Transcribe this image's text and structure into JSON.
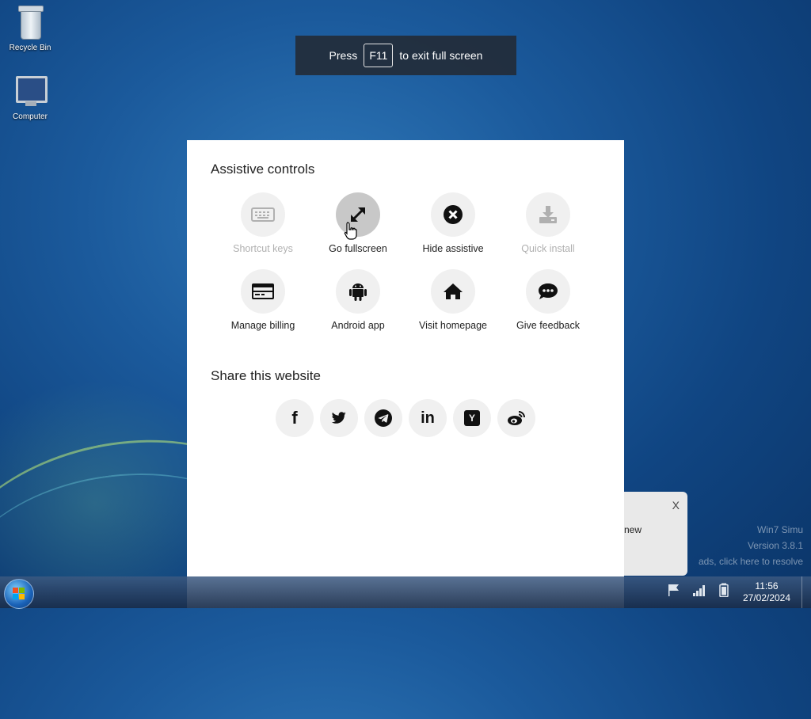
{
  "desktop": {
    "icons": [
      {
        "label": "Recycle Bin"
      },
      {
        "label": "Computer"
      }
    ]
  },
  "fullscreen_banner": {
    "prefix": "Press",
    "key": "F11",
    "suffix": "to exit full screen"
  },
  "panel": {
    "assistive_title": "Assistive controls",
    "controls": [
      {
        "label": "Shortcut keys",
        "icon": "keyboard-icon",
        "state": "disabled"
      },
      {
        "label": "Go fullscreen",
        "icon": "expand-icon",
        "state": "active"
      },
      {
        "label": "Hide assistive",
        "icon": "close-circle-icon",
        "state": "enabled"
      },
      {
        "label": "Quick install",
        "icon": "download-icon",
        "state": "disabled"
      },
      {
        "label": "Manage billing",
        "icon": "credit-card-icon",
        "state": "enabled"
      },
      {
        "label": "Android app",
        "icon": "android-icon",
        "state": "enabled"
      },
      {
        "label": "Visit homepage",
        "icon": "home-icon",
        "state": "enabled"
      },
      {
        "label": "Give feedback",
        "icon": "chat-icon",
        "state": "enabled"
      }
    ],
    "share_title": "Share this website",
    "share": [
      {
        "icon": "facebook-icon",
        "glyph": "f"
      },
      {
        "icon": "twitter-icon",
        "glyph": ""
      },
      {
        "icon": "telegram-icon",
        "glyph": ""
      },
      {
        "icon": "linkedin-icon",
        "glyph": "in"
      },
      {
        "icon": "ycombinator-icon",
        "glyph": "Y"
      },
      {
        "icon": "weibo-icon",
        "glyph": ""
      }
    ]
  },
  "notification": {
    "close": "X",
    "text": "new"
  },
  "watermark": {
    "line1": "Win7 Simu",
    "line2": "Version 3.8.1",
    "line3": "ads, click here to resolve"
  },
  "taskbar": {
    "time": "11:56",
    "date": "27/02/2024"
  }
}
